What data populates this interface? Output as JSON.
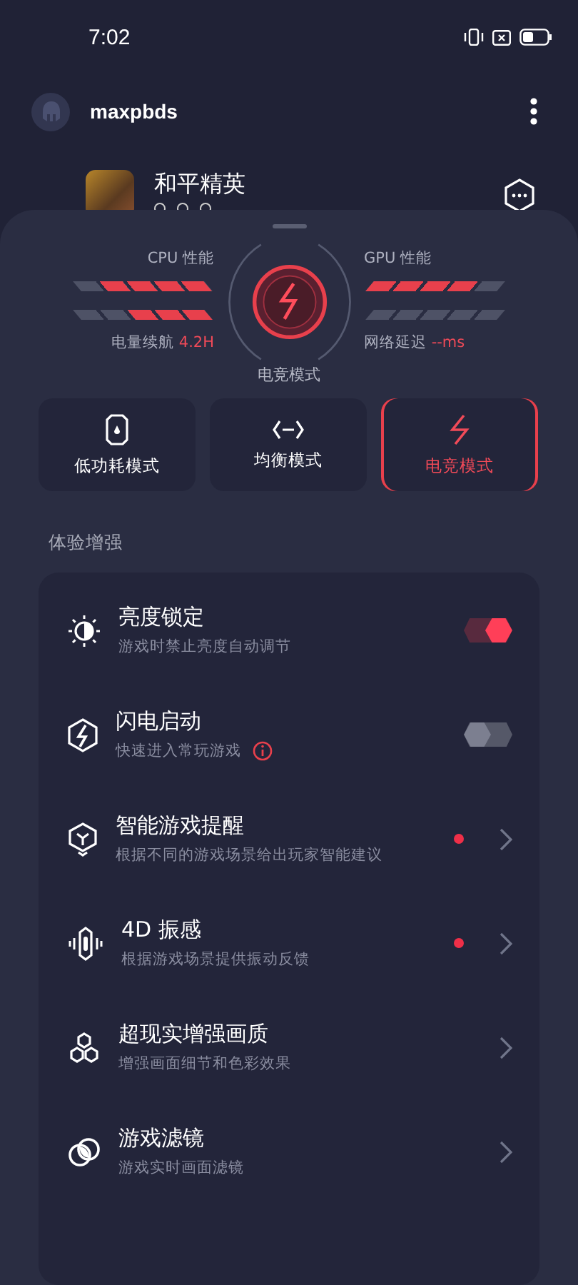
{
  "status_bar": {
    "time": "7:02"
  },
  "account": {
    "username": "maxpbds"
  },
  "game": {
    "title": "和平精英"
  },
  "performance": {
    "cpu": {
      "label": "CPU 性能",
      "level": 0.8
    },
    "battery": {
      "label": "电量续航",
      "value": "4.2H",
      "level": 0.6
    },
    "gpu": {
      "label": "GPU 性能",
      "level": 0.8
    },
    "network": {
      "label": "网络延迟",
      "value": "--ms",
      "level": 0
    },
    "current_mode": "电竞模式"
  },
  "modes": [
    {
      "label": "低功耗模式",
      "selected": false
    },
    {
      "label": "均衡模式",
      "selected": false
    },
    {
      "label": "电竞模式",
      "selected": true
    }
  ],
  "section_title": "体验增强",
  "features": [
    {
      "kind": "toggle",
      "title": "亮度锁定",
      "subtitle": "游戏时禁止亮度自动调节",
      "on": true,
      "info": false
    },
    {
      "kind": "toggle",
      "title": "闪电启动",
      "subtitle": "快速进入常玩游戏",
      "on": false,
      "info": true
    },
    {
      "kind": "link",
      "title": "智能游戏提醒",
      "subtitle": "根据不同的游戏场景给出玩家智能建议",
      "dot": true
    },
    {
      "kind": "link",
      "title": "4D 振感",
      "subtitle": "根据游戏场景提供振动反馈",
      "dot": true
    },
    {
      "kind": "link",
      "title": "超现实增强画质",
      "subtitle": "增强画面细节和色彩效果",
      "dot": false
    },
    {
      "kind": "link",
      "title": "游戏滤镜",
      "subtitle": "游戏实时画面滤镜",
      "dot": false
    }
  ]
}
